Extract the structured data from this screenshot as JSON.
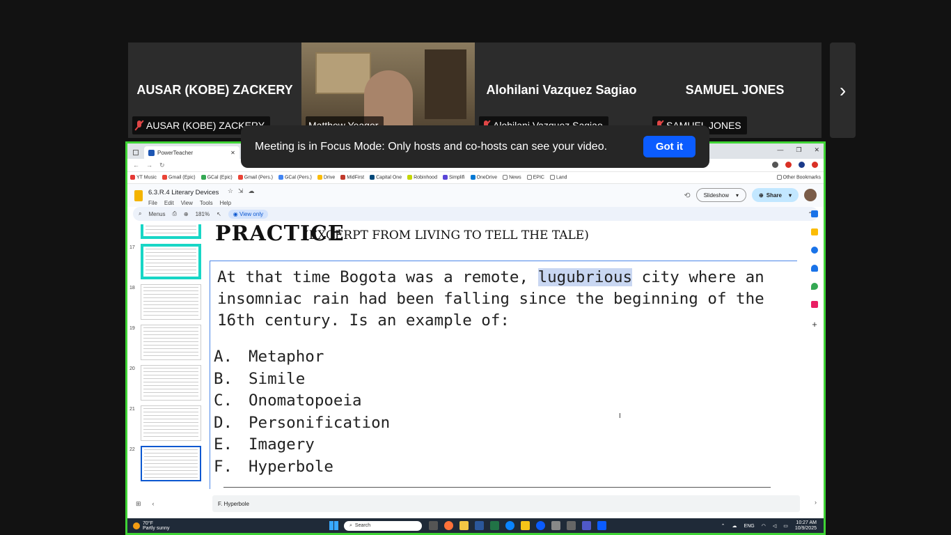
{
  "participants": [
    {
      "name": "AUSAR (KOBE) ZACKERY",
      "tag": "AUSAR (KOBE) ZACKERY",
      "muted": true
    },
    {
      "name": "",
      "tag": "Matthew Yeager",
      "muted": false,
      "video": true
    },
    {
      "name": "Alohilani Vazquez Sagiao",
      "tag": "Alohilani Vazquez Sagiao",
      "muted": true
    },
    {
      "name": "SAMUEL JONES",
      "tag": "SAMUEL JONES",
      "muted": true
    }
  ],
  "strip": {
    "next_arrow": "›"
  },
  "toast": {
    "message": "Meeting is in Focus Mode: Only hosts and co-hosts can see your video.",
    "button": "Got it"
  },
  "browser": {
    "tabs": [
      {
        "label": "PowerTeacher",
        "close": "✕"
      },
      {
        "label": "Re",
        "close": ""
      }
    ],
    "window_controls": [
      "—",
      "❐",
      "✕"
    ],
    "bookmarks": [
      "YT Music",
      "Gmail (Epic)",
      "GCal (Epic)",
      "Gmail (Pers.)",
      "GCal (Pers.)",
      "Drive",
      "MidFirst",
      "Capital One",
      "Robinhood",
      "Simplifi",
      "OneDrive",
      "News",
      "EPIC",
      "Land"
    ],
    "other_bookmarks": "Other Bookmarks"
  },
  "slides": {
    "doc_title": "6.3.R.4 Literary Devices",
    "menus": [
      "File",
      "Edit",
      "View",
      "Tools",
      "Help"
    ],
    "slideshow_label": "Slideshow",
    "share_label": "Share",
    "toolbar": {
      "menus_label": "Menus",
      "zoom": "181%",
      "view_only": "View only"
    },
    "thumb_numbers": [
      "",
      "17",
      "18",
      "19",
      "20",
      "21",
      "22"
    ],
    "slide": {
      "heading": "PRACTICE",
      "subheading": "(EXCERPT FROM LIVING TO TELL THE TALE)",
      "question_before": "At that time Bogota was a remote, ",
      "question_highlight": "lugubrious",
      "question_after": " city where an insomniac rain had been falling since the beginning of the 16th century. Is an example of:",
      "options": [
        {
          "letter": "A.",
          "text": "Metaphor"
        },
        {
          "letter": "B.",
          "text": "Simile"
        },
        {
          "letter": "C.",
          "text": "Onomatopoeia"
        },
        {
          "letter": "D.",
          "text": "Personification"
        },
        {
          "letter": "E.",
          "text": "Imagery"
        },
        {
          "letter": "F.",
          "text": "Hyperbole"
        }
      ]
    },
    "speaker_notes": "F. Hyperbole"
  },
  "taskbar": {
    "weather_temp": "70°F",
    "weather_desc": "Partly sunny",
    "search_placeholder": "Search",
    "language": "ENG",
    "time": "10:27 AM",
    "date": "10/9/2025"
  }
}
